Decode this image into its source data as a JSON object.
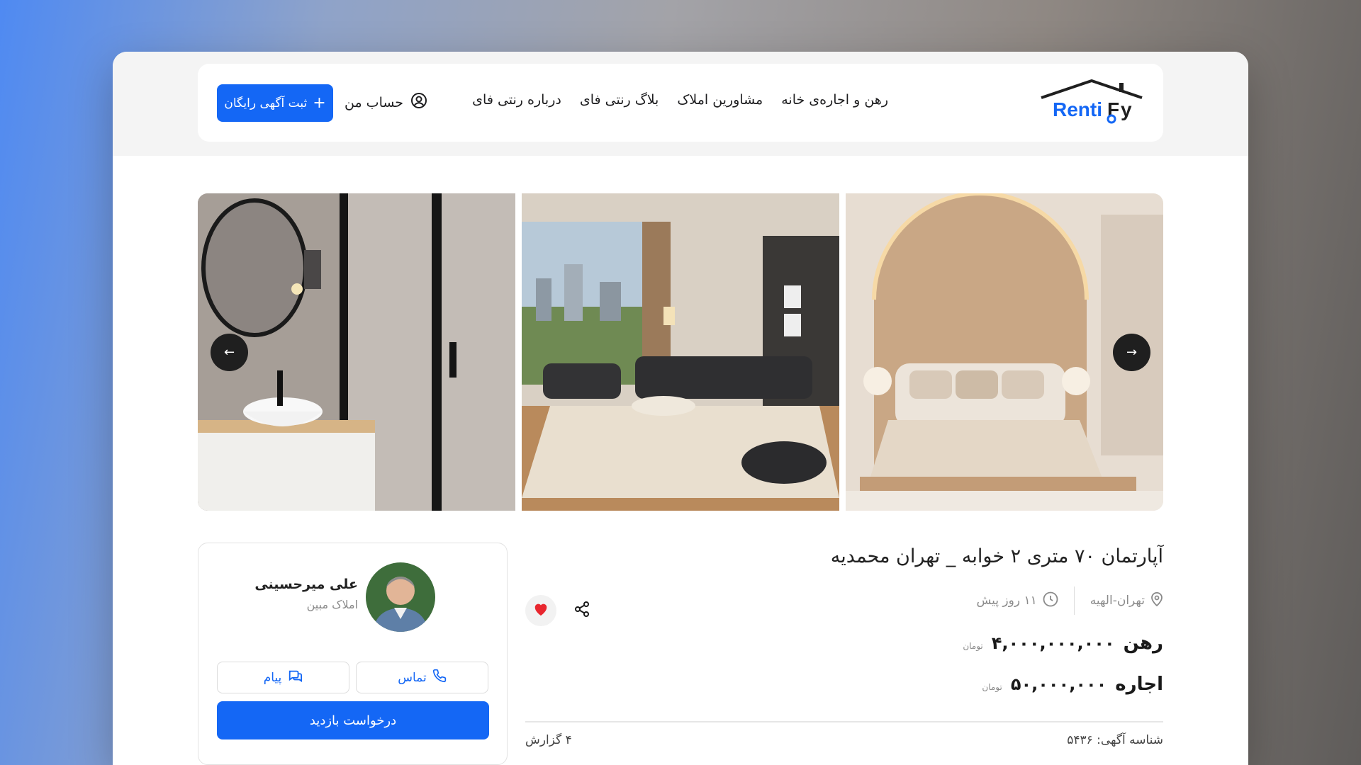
{
  "brand": {
    "logo_text": "Rentify",
    "accent": "#1467f5"
  },
  "nav": {
    "links": [
      "رهن و اجاره‌ی خانه",
      "مشاورین املاک",
      "بلاگ رنتی فای",
      "درباره رنتی فای"
    ],
    "account_label": "حساب من",
    "post_ad_label": "ثبت آگهی رایگان"
  },
  "gallery": {
    "photos": [
      "bedroom-photo",
      "living-room-photo",
      "bathroom-photo"
    ]
  },
  "listing": {
    "title": "آپارتمان ۷۰ متری ۲ خوابه _ تهران محمدیه",
    "location": "تهران-الهیه",
    "posted": "۱۱ روز پیش",
    "mortgage_label": "رهن",
    "mortgage_value": "۴,۰۰۰,۰۰۰,۰۰۰",
    "rent_label": "اجاره",
    "rent_value": "۵۰,۰۰۰,۰۰۰",
    "currency": "تومان",
    "ad_id": "شناسه آگهی: ۵۴۳۶",
    "reports": "۴ گزارش"
  },
  "agent": {
    "name": "علی میرحسینی",
    "agency": "املاک مبین",
    "call_label": "تماس",
    "message_label": "پیام",
    "visit_label": "درخواست بازدید"
  }
}
